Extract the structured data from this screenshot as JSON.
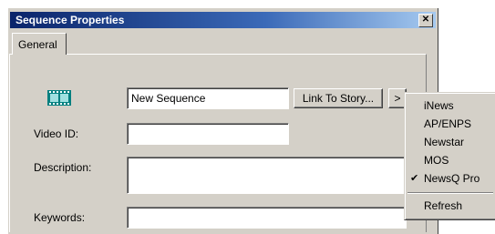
{
  "window": {
    "title": "Sequence Properties",
    "close_glyph": "✕"
  },
  "tabs": [
    {
      "label": "General"
    }
  ],
  "form": {
    "name_value": "New Sequence",
    "link_button_label": "Link To Story...",
    "more_button_label": ">",
    "video_id_label": "Video ID:",
    "video_id_value": "",
    "description_label": "Description:",
    "description_value": "",
    "keywords_label": "Keywords:",
    "keywords_value": "",
    "icon": "film-strip-icon"
  },
  "menu": {
    "items": [
      {
        "label": "iNews",
        "checked": false
      },
      {
        "label": "AP/ENPS",
        "checked": false
      },
      {
        "label": "Newstar",
        "checked": false
      },
      {
        "label": "MOS",
        "checked": false
      },
      {
        "label": "NewsQ Pro",
        "checked": true
      }
    ],
    "check_glyph": "✔",
    "refresh_label": "Refresh"
  },
  "colors": {
    "dialog_bg": "#d4d0c8",
    "title_start": "#0a246a",
    "title_end": "#a6caf0",
    "film_icon": "#008080"
  }
}
